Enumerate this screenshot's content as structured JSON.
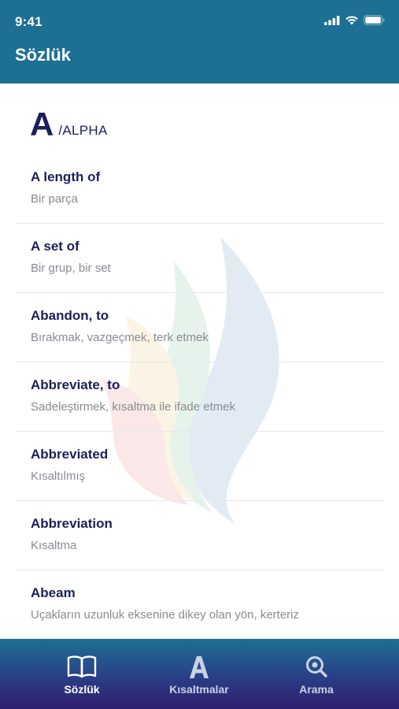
{
  "status": {
    "time": "9:41"
  },
  "header": {
    "title": "Sözlük"
  },
  "section": {
    "letter": "A",
    "label": "/ALPHA"
  },
  "entries": [
    {
      "term": "A length of",
      "meaning": "Bir parça"
    },
    {
      "term": "A set of",
      "meaning": "Bir grup, bir set"
    },
    {
      "term": "Abandon, to",
      "meaning": "Bırakmak, vazgeçmek, terk etmek"
    },
    {
      "term": "Abbreviate, to",
      "meaning": "Sadeleştirmek, kısaltma ile ifade etmek"
    },
    {
      "term": "Abbreviated",
      "meaning": "Kısaltılmış"
    },
    {
      "term": "Abbreviation",
      "meaning": "Kısaltma"
    },
    {
      "term": "Abeam",
      "meaning": "Uçakların uzunluk eksenine dikey olan yön, kerteriz"
    }
  ],
  "tabs": [
    {
      "label": "Sözlük",
      "icon": "book-icon",
      "active": true
    },
    {
      "label": "Kısaltmalar",
      "icon": "letter-a-icon",
      "active": false
    },
    {
      "label": "Arama",
      "icon": "search-icon",
      "active": false
    }
  ],
  "colors": {
    "header": "#1d6f94",
    "term": "#1c1f5c",
    "meaning": "#8a8a92",
    "tabbar_top": "#1d6f94",
    "tabbar_bottom": "#2e1d6e"
  }
}
